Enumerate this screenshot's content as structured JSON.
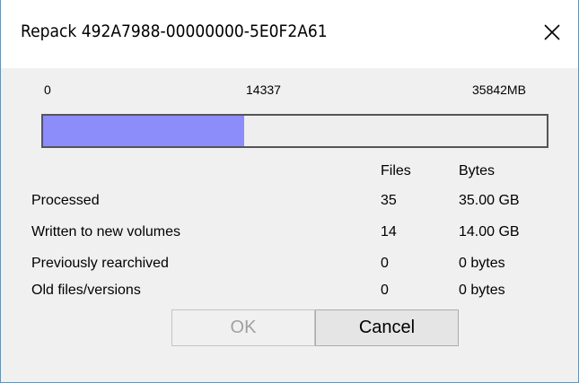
{
  "window": {
    "title": "Repack 492A7988-00000000-5E0F2A61"
  },
  "progress": {
    "min_label": "0",
    "current_label": "14337",
    "max_label": "35842MB",
    "fraction": 0.4,
    "fill_color": "#8c8cfa"
  },
  "stats": {
    "headers": {
      "files": "Files",
      "bytes": "Bytes"
    },
    "rows": [
      {
        "label": "Processed",
        "files": "35",
        "bytes": "35.00 GB"
      },
      {
        "label": "Written to new volumes",
        "files": "14",
        "bytes": "14.00 GB"
      },
      {
        "label": "Previously rearchived",
        "files": "0",
        "bytes": "0 bytes"
      },
      {
        "label": "Old files/versions",
        "files": "0",
        "bytes": "0 bytes"
      }
    ]
  },
  "buttons": {
    "ok_label": "OK",
    "ok_enabled": false,
    "cancel_label": "Cancel"
  }
}
